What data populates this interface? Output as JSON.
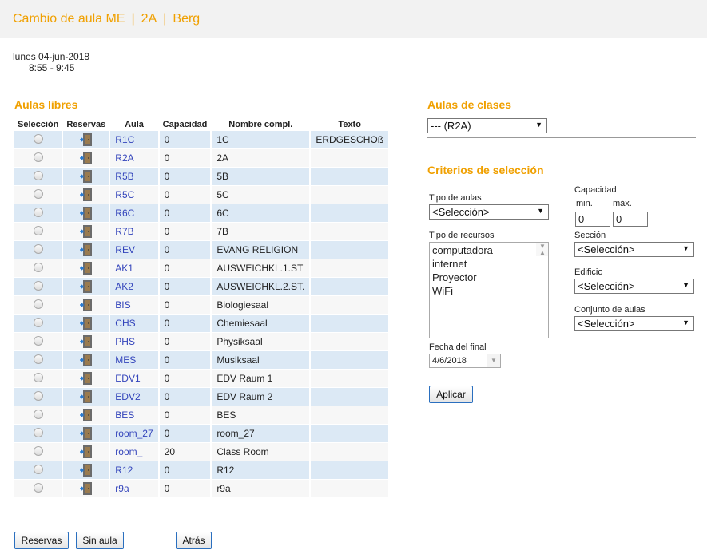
{
  "header": {
    "part1": "Cambio de aula ME",
    "part2": "2A",
    "part3": "Berg",
    "separator": "|"
  },
  "date": "lunes 04-jun-2018",
  "time": "8:55 - 9:45",
  "free_rooms": {
    "title": "Aulas libres",
    "columns": [
      "Selección",
      "Reservas",
      "Aula",
      "Capacidad",
      "Nombre compl.",
      "Texto"
    ],
    "rows": [
      {
        "aula": "R1C",
        "cap": "0",
        "name": "1C",
        "text": "ERDGESCHOß"
      },
      {
        "aula": "R2A",
        "cap": "0",
        "name": "2A",
        "text": ""
      },
      {
        "aula": "R5B",
        "cap": "0",
        "name": "5B",
        "text": ""
      },
      {
        "aula": "R5C",
        "cap": "0",
        "name": "5C",
        "text": ""
      },
      {
        "aula": "R6C",
        "cap": "0",
        "name": "6C",
        "text": ""
      },
      {
        "aula": "R7B",
        "cap": "0",
        "name": "7B",
        "text": ""
      },
      {
        "aula": "REV",
        "cap": "0",
        "name": "EVANG RELIGION",
        "text": ""
      },
      {
        "aula": "AK1",
        "cap": "0",
        "name": "AUSWEICHKL.1.ST",
        "text": ""
      },
      {
        "aula": "AK2",
        "cap": "0",
        "name": "AUSWEICHKL.2.ST.",
        "text": ""
      },
      {
        "aula": "BIS",
        "cap": "0",
        "name": "Biologiesaal",
        "text": ""
      },
      {
        "aula": "CHS",
        "cap": "0",
        "name": "Chemiesaal",
        "text": ""
      },
      {
        "aula": "PHS",
        "cap": "0",
        "name": "Physiksaal",
        "text": ""
      },
      {
        "aula": "MES",
        "cap": "0",
        "name": "Musiksaal",
        "text": ""
      },
      {
        "aula": "EDV1",
        "cap": "0",
        "name": "EDV Raum 1",
        "text": ""
      },
      {
        "aula": "EDV2",
        "cap": "0",
        "name": "EDV Raum 2",
        "text": ""
      },
      {
        "aula": "BES",
        "cap": "0",
        "name": "BES",
        "text": ""
      },
      {
        "aula": "room_27",
        "cap": "0",
        "name": "room_27",
        "text": ""
      },
      {
        "aula": "room_",
        "cap": "20",
        "name": "Class Room",
        "text": ""
      },
      {
        "aula": "R12",
        "cap": "0",
        "name": "R12",
        "text": ""
      },
      {
        "aula": "r9a",
        "cap": "0",
        "name": "r9a",
        "text": ""
      }
    ]
  },
  "class_rooms": {
    "title": "Aulas de clases",
    "selected": "--- (R2A)"
  },
  "criteria": {
    "title": "Criterios de selección",
    "room_type_label": "Tipo de aulas",
    "room_type_value": "<Selección>",
    "capacity_label": "Capacidad",
    "min_label": "min.",
    "max_label": "máx.",
    "min_value": "0",
    "max_value": "0",
    "resource_label": "Tipo de recursos",
    "resources": [
      "computadora",
      "internet",
      "Proyector",
      "WiFi"
    ],
    "section_label": "Sección",
    "section_value": "<Selección>",
    "building_label": "Edificio",
    "building_value": "<Selección>",
    "roomset_label": "Conjunto de aulas",
    "roomset_value": "<Selección>",
    "end_date_label": "Fecha del final",
    "end_date_value": "4/6/2018",
    "apply_label": "Aplicar"
  },
  "footer": {
    "reservations": "Reservas",
    "no_room": "Sin aula",
    "back": "Atrás"
  },
  "colors": {
    "accent": "#f0a000",
    "row_blue": "#dce9f5",
    "row_light": "#f7f7f7",
    "link": "#3344bb"
  }
}
